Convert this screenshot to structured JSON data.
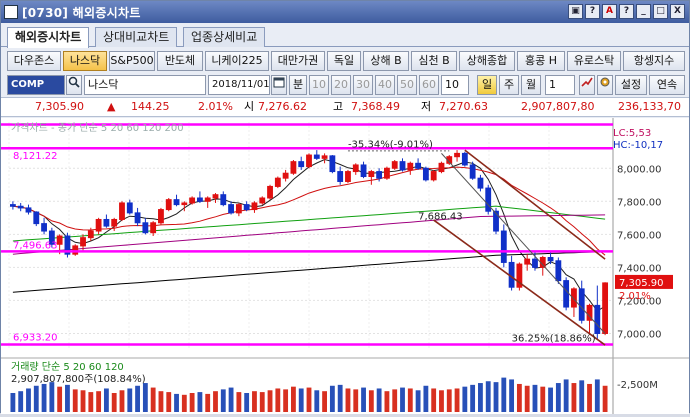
{
  "window": {
    "title": "[0730] 해외증시차트",
    "controls": [
      "▣",
      "?",
      "A",
      "?",
      "_",
      "□",
      "X"
    ]
  },
  "tabs": [
    {
      "label": "해외증시차트",
      "active": true
    },
    {
      "label": "상대비교차트",
      "active": false
    },
    {
      "label": "업종상세비교",
      "active": false
    }
  ],
  "index_buttons": [
    {
      "label": "다우존스"
    },
    {
      "label": "나스닥",
      "active": true
    },
    {
      "label": "S&P500"
    },
    {
      "label": "반도체"
    },
    {
      "label": "니케이225"
    },
    {
      "label": "대만가권"
    },
    {
      "label": "독일"
    },
    {
      "label": "상해 B"
    },
    {
      "label": "심천 B"
    },
    {
      "label": "상해종합"
    },
    {
      "label": "홍콩 H"
    },
    {
      "label": "유로스탁"
    },
    {
      "label": "항셍지수"
    }
  ],
  "controls_row": {
    "code": "COMP",
    "name": "나스닥",
    "date": "2018/11/01",
    "period_label": "분",
    "minutes": [
      "10",
      "20",
      "30",
      "40",
      "50",
      "60"
    ],
    "count_value": "10",
    "day_label": "일",
    "week_label": "주",
    "month_label": "월",
    "qty_value": "1",
    "settings_label": "설정",
    "continuous_label": "연속"
  },
  "quote": {
    "price": "7,305.90",
    "change_arrow": "▲",
    "change": "144.25",
    "change_pct": "2.01%",
    "open_label": "시",
    "open": "7,276.62",
    "high_label": "고",
    "high": "7,368.49",
    "low_label": "저",
    "low": "7,270.63",
    "value1": "2,907,807,80",
    "value2": "236,133,70"
  },
  "chart_data": {
    "type": "candlestick",
    "price_legend": "가격차트 - 종가 단순 5 20 60 120 200",
    "y_ticks": [
      "8,000.00",
      "7,800.00",
      "7,600.00",
      "7,400.00",
      "7,200.00",
      "7,000.00"
    ],
    "ylim": [
      6900,
      8250
    ],
    "hlines": [
      8265,
      8121.22,
      7496.63,
      6933.2
    ],
    "level_labels": [
      "8,121.22",
      "7,496.63",
      "6,933.20"
    ],
    "lc_label": "LC:5,53",
    "hc_label": "HC:-10,17",
    "annotations": [
      {
        "text": "-35.34%(-9.01%)"
      },
      {
        "text": "7,686.43"
      },
      {
        "text": "36.25%(18.86%)"
      }
    ],
    "last_price_tag": "7,305.90",
    "last_pct_tag": "2.01%",
    "candles": [
      [
        7780,
        7800,
        7750,
        7770
      ],
      [
        7770,
        7790,
        7740,
        7760
      ],
      [
        7760,
        7780,
        7720,
        7735
      ],
      [
        7735,
        7740,
        7650,
        7665
      ],
      [
        7665,
        7700,
        7600,
        7620
      ],
      [
        7620,
        7640,
        7520,
        7540
      ],
      [
        7540,
        7600,
        7480,
        7590
      ],
      [
        7590,
        7610,
        7460,
        7480
      ],
      [
        7480,
        7540,
        7470,
        7530
      ],
      [
        7530,
        7600,
        7500,
        7580
      ],
      [
        7580,
        7640,
        7560,
        7620
      ],
      [
        7620,
        7700,
        7600,
        7690
      ],
      [
        7690,
        7720,
        7640,
        7650
      ],
      [
        7650,
        7700,
        7620,
        7690
      ],
      [
        7690,
        7800,
        7680,
        7790
      ],
      [
        7790,
        7810,
        7720,
        7730
      ],
      [
        7730,
        7760,
        7650,
        7670
      ],
      [
        7670,
        7700,
        7600,
        7610
      ],
      [
        7610,
        7680,
        7590,
        7670
      ],
      [
        7670,
        7760,
        7660,
        7750
      ],
      [
        7750,
        7820,
        7740,
        7810
      ],
      [
        7810,
        7840,
        7770,
        7780
      ],
      [
        7780,
        7800,
        7740,
        7790
      ],
      [
        7790,
        7830,
        7780,
        7820
      ],
      [
        7820,
        7860,
        7790,
        7800
      ],
      [
        7800,
        7830,
        7760,
        7820
      ],
      [
        7820,
        7850,
        7790,
        7840
      ],
      [
        7840,
        7860,
        7770,
        7780
      ],
      [
        7780,
        7800,
        7720,
        7730
      ],
      [
        7730,
        7790,
        7710,
        7780
      ],
      [
        7780,
        7800,
        7740,
        7750
      ],
      [
        7750,
        7800,
        7730,
        7790
      ],
      [
        7790,
        7830,
        7780,
        7820
      ],
      [
        7820,
        7900,
        7810,
        7890
      ],
      [
        7890,
        7950,
        7880,
        7940
      ],
      [
        7940,
        7990,
        7920,
        7970
      ],
      [
        7970,
        8050,
        7960,
        8040
      ],
      [
        8040,
        8070,
        7990,
        8010
      ],
      [
        8010,
        8090,
        8000,
        8080
      ],
      [
        8080,
        8110,
        8050,
        8060
      ],
      [
        8060,
        8090,
        8030,
        8075
      ],
      [
        8075,
        8080,
        7970,
        7980
      ],
      [
        7980,
        8010,
        7900,
        7920
      ],
      [
        7920,
        7990,
        7910,
        7980
      ],
      [
        7980,
        8030,
        7960,
        8020
      ],
      [
        8020,
        8040,
        7940,
        7950
      ],
      [
        7950,
        7990,
        7900,
        7980
      ],
      [
        7980,
        8000,
        7920,
        7940
      ],
      [
        7940,
        8010,
        7930,
        8000
      ],
      [
        8000,
        8050,
        7990,
        8040
      ],
      [
        8040,
        8060,
        7980,
        7990
      ],
      [
        7990,
        8040,
        7960,
        8030
      ],
      [
        8030,
        8060,
        7990,
        8000
      ],
      [
        8000,
        8010,
        7920,
        7930
      ],
      [
        7930,
        7990,
        7920,
        7980
      ],
      [
        7980,
        8040,
        7970,
        8030
      ],
      [
        8030,
        8080,
        8020,
        8070
      ],
      [
        8070,
        8110,
        8040,
        8090
      ],
      [
        8090,
        8100,
        8010,
        8020
      ],
      [
        8020,
        8040,
        7930,
        7940
      ],
      [
        7940,
        7960,
        7860,
        7880
      ],
      [
        7880,
        7900,
        7720,
        7740
      ],
      [
        7740,
        7760,
        7600,
        7620
      ],
      [
        7620,
        7660,
        7400,
        7430
      ],
      [
        7430,
        7470,
        7260,
        7280
      ],
      [
        7280,
        7430,
        7260,
        7420
      ],
      [
        7420,
        7480,
        7380,
        7450
      ],
      [
        7450,
        7500,
        7380,
        7400
      ],
      [
        7400,
        7470,
        7350,
        7460
      ],
      [
        7460,
        7500,
        7420,
        7440
      ],
      [
        7440,
        7460,
        7300,
        7320
      ],
      [
        7320,
        7340,
        7140,
        7160
      ],
      [
        7160,
        7280,
        7100,
        7270
      ],
      [
        7270,
        7320,
        7060,
        7080
      ],
      [
        7080,
        7180,
        7000,
        7170
      ],
      [
        7170,
        7290,
        6960,
        7000
      ],
      [
        7000,
        7310,
        6990,
        7306
      ]
    ],
    "ma_series": [
      {
        "period": "5",
        "color": "#202020"
      },
      {
        "period": "20",
        "color": "#d01010"
      },
      {
        "period": "60",
        "color": "#10a010"
      },
      {
        "period": "120",
        "color": "#a00080"
      },
      {
        "period": "200",
        "color": "#000000"
      }
    ],
    "volume_legend": "거래량 단순 5 20 60 120",
    "volume_label": "2,907,807,800주(108.84%)",
    "volume_tick": "-2,500M",
    "volumes": [
      2.1,
      2.3,
      2.6,
      2.9,
      3.1,
      3.3,
      2.8,
      3.0,
      2.5,
      2.4,
      2.2,
      2.3,
      2.6,
      2.1,
      2.4,
      2.6,
      2.9,
      3.2,
      2.7,
      2.3,
      2.2,
      2.0,
      1.9,
      2.1,
      2.2,
      2.0,
      2.3,
      2.5,
      2.7,
      2.2,
      2.1,
      2.3,
      2.2,
      2.4,
      2.6,
      2.5,
      2.8,
      2.6,
      2.7,
      2.4,
      2.3,
      2.9,
      3.0,
      2.6,
      2.5,
      2.7,
      2.4,
      2.6,
      2.3,
      2.5,
      2.7,
      2.6,
      2.4,
      2.9,
      2.6,
      2.4,
      2.5,
      2.6,
      2.8,
      3.0,
      3.2,
      3.4,
      3.3,
      3.8,
      3.6,
      3.1,
      2.9,
      3.0,
      2.8,
      2.7,
      3.2,
      3.6,
      3.2,
      3.5,
      3.1,
      3.6,
      2.9
    ]
  }
}
